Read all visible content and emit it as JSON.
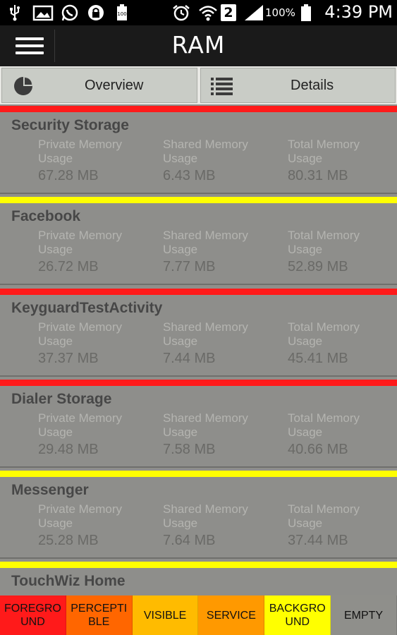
{
  "status_bar": {
    "icons": [
      "usb-icon",
      "image-icon",
      "whatsapp-icon",
      "lock-icon",
      "battery-full-small-icon",
      "alarm-icon",
      "wifi-icon",
      "sim-2-icon",
      "signal-icon",
      "battery-icon"
    ],
    "sim_label": "2",
    "battery_percent": "100%",
    "time": "4:39 PM"
  },
  "action_bar": {
    "title": "RAM"
  },
  "tabs": {
    "overview": "Overview",
    "details": "Details"
  },
  "labels": {
    "private": "Private Memory Usage",
    "shared": "Shared Memory Usage",
    "total": "Total Memory Usage"
  },
  "items": [
    {
      "name": "Security Storage",
      "private": "67.28 MB",
      "shared": "6.43 MB",
      "total": "80.31 MB",
      "color": "#ff1a1a"
    },
    {
      "name": "Facebook",
      "private": "26.72 MB",
      "shared": "7.77 MB",
      "total": "52.89 MB",
      "color": "#ffff00"
    },
    {
      "name": "KeyguardTestActivity",
      "private": "37.37 MB",
      "shared": "7.44 MB",
      "total": "45.41 MB",
      "color": "#ff1a1a"
    },
    {
      "name": "Dialer Storage",
      "private": "29.48 MB",
      "shared": "7.58 MB",
      "total": "40.66 MB",
      "color": "#ff1a1a"
    },
    {
      "name": "Messenger",
      "private": "25.28 MB",
      "shared": "7.64 MB",
      "total": "37.44 MB",
      "color": "#ffff00"
    },
    {
      "name": "TouchWiz Home",
      "private": "",
      "shared": "",
      "total": "",
      "color": "#ffff00"
    }
  ],
  "legend": [
    {
      "label": "FOREGRO UND",
      "color": "#ff1a1a"
    },
    {
      "label": "PERCEPTI BLE",
      "color": "#ff6600"
    },
    {
      "label": "VISIBLE",
      "color": "#ffbb00"
    },
    {
      "label": "SERVICE",
      "color": "#ff9900"
    },
    {
      "label": "BACKGRO UND",
      "color": "#ffff00"
    },
    {
      "label": "EMPTY",
      "color": "#8f8f8b"
    }
  ]
}
